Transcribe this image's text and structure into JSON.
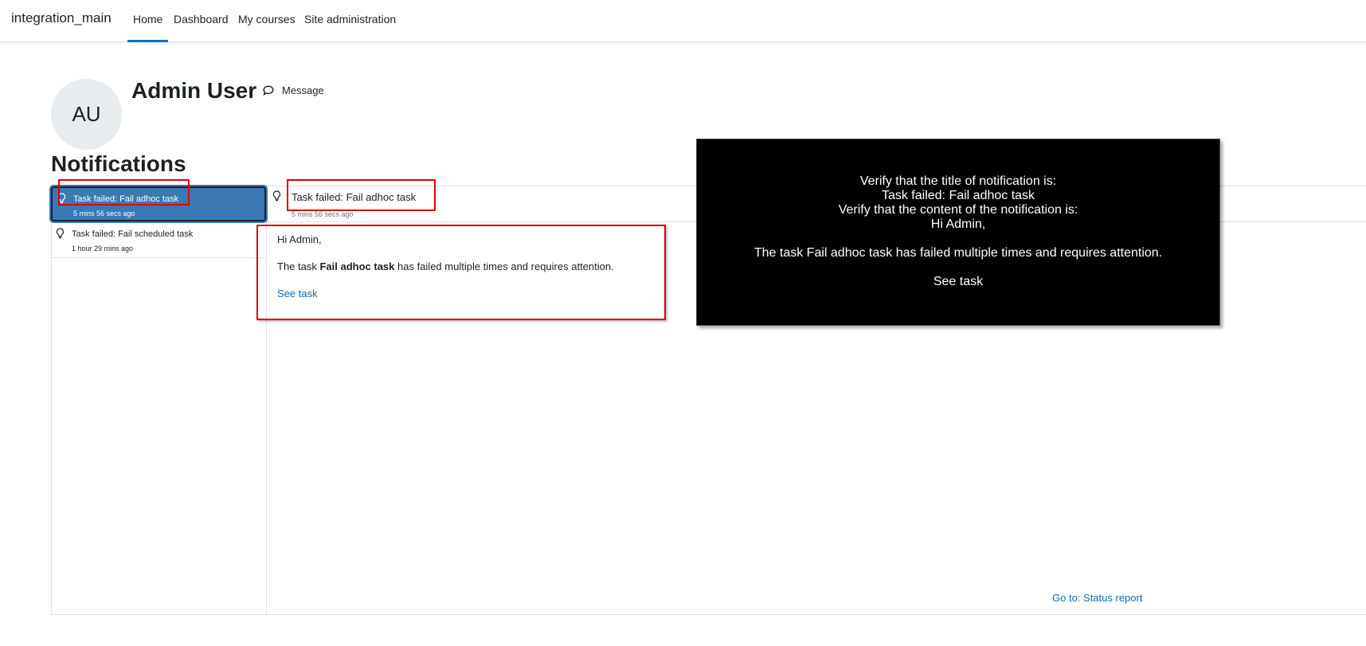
{
  "navbar": {
    "brand": "integration_main",
    "links": [
      {
        "label": "Home",
        "active": true
      },
      {
        "label": "Dashboard",
        "active": false
      },
      {
        "label": "My courses",
        "active": false
      },
      {
        "label": "Site administration",
        "active": false
      }
    ]
  },
  "profile": {
    "initials": "AU",
    "name": "Admin User",
    "message_label": "Message"
  },
  "page_heading": "Notifications",
  "notifications": [
    {
      "title": "Task failed: Fail adhoc task",
      "time": "5 mins 56 secs ago",
      "selected": true
    },
    {
      "title": "Task failed: Fail scheduled task",
      "time": "1 hour 29 mins ago",
      "selected": false
    }
  ],
  "detail": {
    "title": "Task failed: Fail adhoc task",
    "time": "5 mins 56 secs ago",
    "greeting": "Hi Admin,",
    "body_prefix": "The task ",
    "body_bold": "Fail adhoc task",
    "body_suffix": " has failed multiple times and requires attention.",
    "link_label": "See task"
  },
  "footer_link": "Go to: Status report",
  "overlay": {
    "lines": [
      "Verify that the title of notification is:",
      "Task failed: Fail adhoc task",
      "Verify that the content of the notification is:",
      "Hi Admin,",
      "",
      "The task Fail adhoc task has failed multiple times and requires attention.",
      "",
      "See task"
    ]
  },
  "colors": {
    "accent": "#0f6cbf",
    "selected_bg": "#3a79b3",
    "highlight": "#e00000",
    "overlay_bg": "#000000"
  }
}
